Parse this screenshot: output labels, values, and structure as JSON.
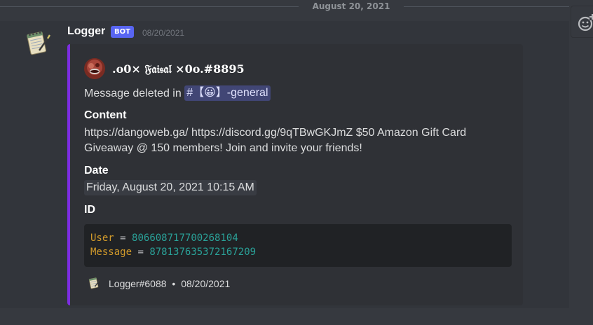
{
  "divider": {
    "date": "August 20, 2021"
  },
  "message": {
    "author": "Logger",
    "bot_tag": "BOT",
    "timestamp": "08/20/2021"
  },
  "embed": {
    "accent_color": "#7d2de1",
    "author_name": ".o0× 𝔉𝔞𝔦𝔰𝔞𝔩 ×0o.#8895",
    "description_prefix": "Message deleted in",
    "channel_mention": "#【😀】-general",
    "fields": {
      "content": {
        "name": "Content",
        "value": "https://dangoweb.ga/ https://discord.gg/9qTBwGKJmZ $50 Amazon Gift Card Giveaway @ 150 members! Join and invite your friends!"
      },
      "date": {
        "name": "Date",
        "value": "Friday, August 20, 2021 10:15 AM"
      },
      "id": {
        "name": "ID",
        "user_key": "User",
        "user_value": "806608717700268104",
        "message_key": "Message",
        "message_value": "878137635372167209",
        "eq": "="
      }
    },
    "footer": {
      "author": "Logger#6088",
      "separator": "•",
      "date": "08/20/2021"
    }
  },
  "icons": {
    "avatar": "notepad-icon",
    "reaction": "add-reaction-icon"
  }
}
